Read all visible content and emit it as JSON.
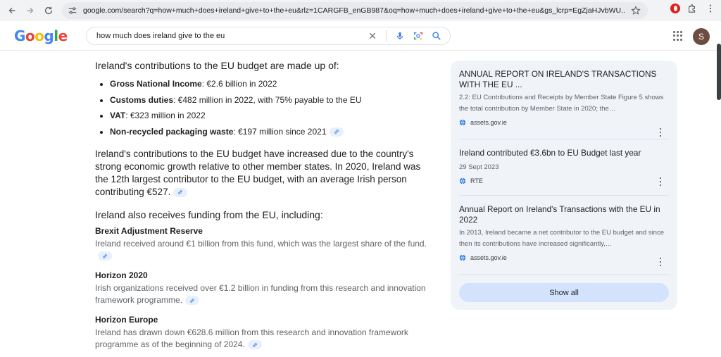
{
  "browser": {
    "url": "google.com/search?q=how+much+does+ireland+give+to+the+eu&rlz=1CARGFB_enGB987&oq=how+much+does+ireland+give+to+the+eu&gs_lcrp=EgZjaHJvbWU..."
  },
  "google": {
    "logo_letters": [
      "G",
      "o",
      "o",
      "g",
      "l",
      "e"
    ],
    "query": "how much does ireland give to the eu",
    "avatar_letter": "S"
  },
  "answer": {
    "heading": "Ireland's contributions to the EU budget are made up of:",
    "bullets": [
      {
        "label": "Gross National Income",
        "text": ": €2.6 billion in 2022"
      },
      {
        "label": "Customs duties",
        "text": ": €482 million in 2022, with 75% payable to the EU"
      },
      {
        "label": "VAT",
        "text": ": €323 million in 2022"
      },
      {
        "label": "Non-recycled packaging waste",
        "text": ": €197 million since 2021"
      }
    ],
    "paragraph": "Ireland's contributions to the EU budget have increased due to the country's strong economic growth relative to other member states. In 2020, Ireland was the 12th largest contributor to the EU budget, with an average Irish person contributing €527.",
    "funding_heading": "Ireland also receives funding from the EU, including:",
    "funding_items": [
      {
        "title": "Brexit Adjustment Reserve",
        "body": "Ireland received around €1 billion from this fund, which was the largest share of the fund."
      },
      {
        "title": "Horizon 2020",
        "body": "Irish organizations received over €1.2 billion in funding from this research and innovation framework programme."
      },
      {
        "title": "Horizon Europe",
        "body": "Ireland has drawn down €628.6 million from this research and innovation framework programme as of the beginning of 2024."
      }
    ]
  },
  "sources": {
    "items": [
      {
        "title": "ANNUAL REPORT ON IRELAND'S TRANSACTIONS WITH THE EU ...",
        "snippet": "2.2: EU Contributions and Receipts by Member State Figure 5 shows the total contribution by Member State in 2020; the…",
        "site": "assets.gov.ie"
      },
      {
        "title": "Ireland contributed €3.6bn to EU Budget last year",
        "snippet": "29 Sept 2023",
        "site": "RTE"
      },
      {
        "title": "Annual Report on Ireland's Transactions with the EU in 2022",
        "snippet": "In 2013, Ireland became a net contributor to the EU budget and since then its contributions have increased significantly,…",
        "site": "assets.gov.ie"
      }
    ],
    "show_all_label": "Show all"
  }
}
